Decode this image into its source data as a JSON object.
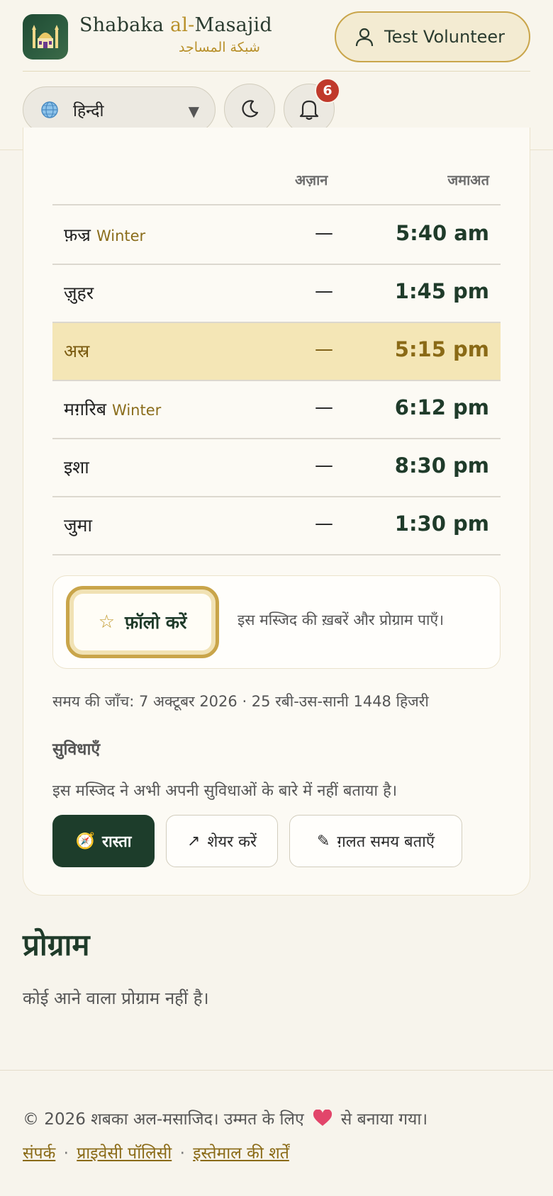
{
  "header": {
    "brand_prefix": "Shabaka ",
    "brand_accent": "al-",
    "brand_suffix": "Masajid",
    "brand_arabic": "شبكة المساجد",
    "user_label": "Test Volunteer",
    "language": "हिन्दी",
    "notification_count": "6"
  },
  "times": {
    "col_azan": "अज़ान",
    "col_jamaat": "जमाअत",
    "rows": [
      {
        "name": "फ़ज्र",
        "tag": "Winter",
        "azan": "—",
        "jamaat": "5:40 am"
      },
      {
        "name": "ज़ुहर",
        "tag": "",
        "azan": "—",
        "jamaat": "1:45 pm"
      },
      {
        "name": "अस्र",
        "tag": "",
        "azan": "—",
        "jamaat": "5:15 pm"
      },
      {
        "name": "मग़रिब",
        "tag": "Winter",
        "azan": "—",
        "jamaat": "6:12 pm"
      },
      {
        "name": "इशा",
        "tag": "",
        "azan": "—",
        "jamaat": "8:30 pm"
      },
      {
        "name": "जुमा",
        "tag": "",
        "azan": "—",
        "jamaat": "1:30 pm"
      }
    ]
  },
  "follow": {
    "button_label": "फ़ॉलो करें",
    "description": "इस मस्जिद की ख़बरें और प्रोग्राम पाएँ।"
  },
  "verified_text": "समय की जाँच: 7 अक्टूबर 2026 · 25 रबी-उस-सानी 1448 हिजरी",
  "amenities": {
    "title": "सुविधाएँ",
    "empty_text": "इस मस्जिद ने अभी अपनी सुविधाओं के बारे में नहीं बताया है।"
  },
  "actions": {
    "directions": "रास्ता",
    "share": "शेयर करें",
    "report": "ग़लत समय बताएँ"
  },
  "programs": {
    "title": "प्रोग्राम",
    "empty_text": "कोई आने वाला प्रोग्राम नहीं है।"
  },
  "footer": {
    "copyright_before": "© 2026 शबका अल-मसाजिद। उम्मत के लिए",
    "copyright_after": "से बनाया गया।",
    "link_contact": "संपर्क",
    "link_privacy": "प्राइवेसी पॉलिसी",
    "link_terms": "इस्तेमाल की शर्तें",
    "separator": "·"
  },
  "colors": {
    "brand_green": "#1d3d2b",
    "gold": "#c9a54a",
    "highlight_row": "#f4e6b6",
    "badge_red": "#c0392b"
  },
  "icons": {
    "logo": "mosque-icon",
    "user": "user-icon",
    "language": "globe-icon",
    "theme": "moon-icon",
    "notifications": "bell-icon",
    "follow": "star-icon",
    "directions": "compass-icon",
    "share": "arrow-icon",
    "report": "pencil-icon",
    "footer": "heart-icon"
  }
}
